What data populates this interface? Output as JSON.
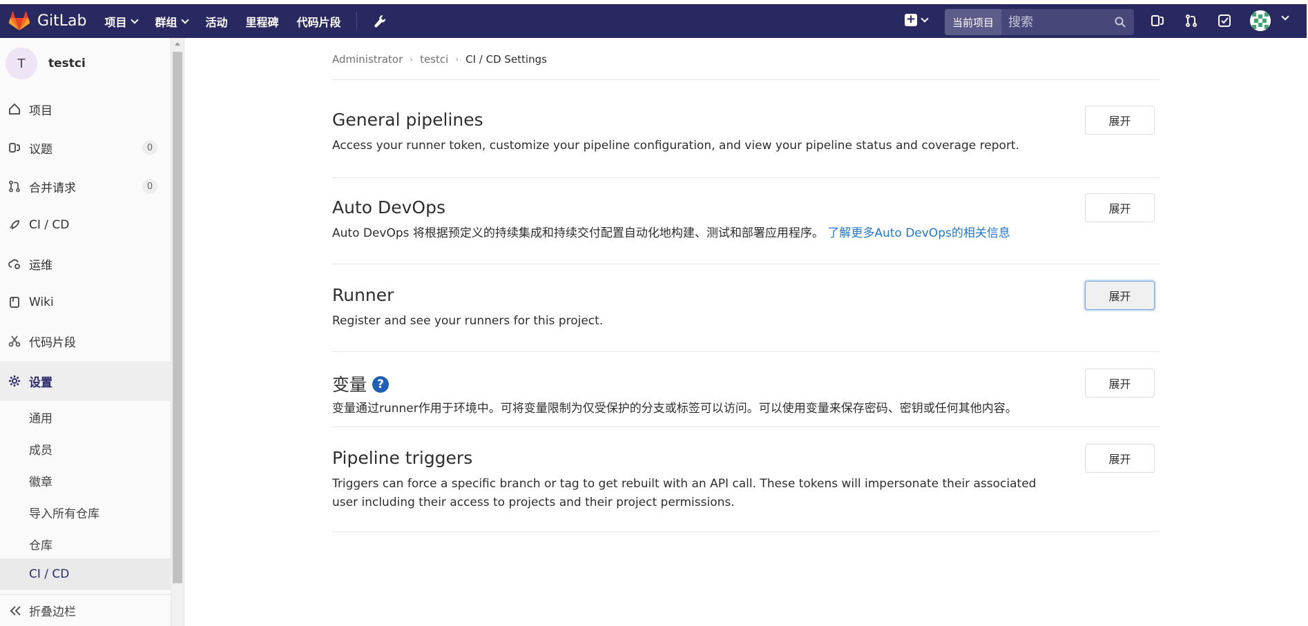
{
  "app": {
    "name": "GitLab"
  },
  "topnav": {
    "items": [
      "项目",
      "群组",
      "活动",
      "里程碑",
      "代码片段"
    ],
    "search": {
      "scope": "当前项目",
      "placeholder": "搜索"
    }
  },
  "sidebar": {
    "project_initial": "T",
    "project_name": "testci",
    "items": [
      {
        "label": "项目",
        "icon": "home-icon"
      },
      {
        "label": "议题",
        "icon": "issues-icon",
        "count": "0"
      },
      {
        "label": "合并请求",
        "icon": "merge-request-icon",
        "count": "0"
      },
      {
        "label": "CI / CD",
        "icon": "rocket-icon"
      },
      {
        "label": "运维",
        "icon": "cloud-gear-icon"
      },
      {
        "label": "Wiki",
        "icon": "book-icon"
      },
      {
        "label": "代码片段",
        "icon": "scissors-icon"
      },
      {
        "label": "设置",
        "icon": "gear-icon"
      }
    ],
    "settings_sub": [
      "通用",
      "成员",
      "徽章",
      "导入所有仓库",
      "仓库",
      "CI / CD"
    ],
    "collapse_label": "折叠边栏"
  },
  "breadcrumb": [
    "Administrator",
    "testci",
    "CI / CD Settings"
  ],
  "sections": [
    {
      "title": "General pipelines",
      "desc": "Access your runner token, customize your pipeline configuration, and view your pipeline status and coverage report.",
      "button": "展开"
    },
    {
      "title": "Auto DevOps",
      "desc": "Auto DevOps 将根据预定义的持续集成和持续交付配置自动化地构建、测试和部署应用程序。",
      "link": "了解更多Auto DevOps的相关信息",
      "button": "展开"
    },
    {
      "title": "Runner",
      "desc": "Register and see your runners for this project.",
      "button": "展开"
    },
    {
      "title": "变量",
      "desc": "变量通过runner作用于环境中。可将变量限制为仅受保护的分支或标签可以访问。可以使用变量来保存密码、密钥或任何其他内容。",
      "button": "展开"
    },
    {
      "title": "Pipeline triggers",
      "desc": "Triggers can force a specific branch or tag to get rebuilt with an API call. These tokens will impersonate their associated user including their access to projects and their project permissions.",
      "button": "展开"
    }
  ],
  "colors": {
    "nav_bg": "#292961",
    "link": "#1f78d1",
    "help": "#1f5fb5"
  }
}
